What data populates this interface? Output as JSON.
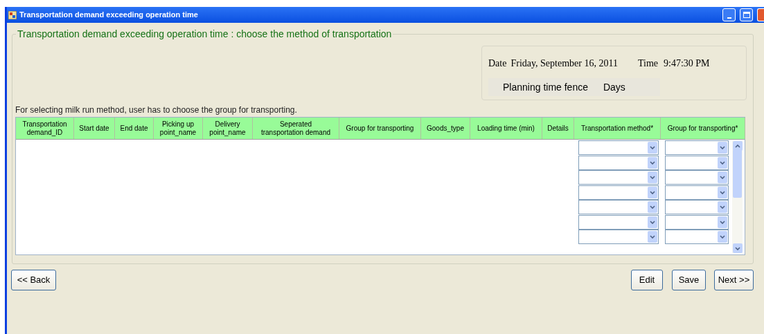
{
  "window": {
    "title": "Transportation demand exceeding operation time"
  },
  "group": {
    "title": "Transportation demand exceeding operation time : choose the method of transportation"
  },
  "info": {
    "date_label": "Date",
    "date": "Friday, September 16, 2011",
    "time_label": "Time",
    "time": "9:47:30 PM",
    "fence_label": "Planning time fence",
    "fence_unit": "Days"
  },
  "instruction": "For selecting milk run method, user has to choose the group for transporting.",
  "table": {
    "columns": [
      {
        "label": "Transportation demand_ID",
        "kind": "text"
      },
      {
        "label": "Start date",
        "kind": "text"
      },
      {
        "label": "End date",
        "kind": "text"
      },
      {
        "label": "Picking up point_name",
        "kind": "text"
      },
      {
        "label": "Delivery point_name",
        "kind": "text"
      },
      {
        "label": "Seperated transportation demand",
        "kind": "text"
      },
      {
        "label": "Group for transporting",
        "kind": "text"
      },
      {
        "label": "Goods_type",
        "kind": "text"
      },
      {
        "label": "Loading time (min)",
        "kind": "text"
      },
      {
        "label": "Details",
        "kind": "text"
      },
      {
        "label": "Transportation method*",
        "kind": "dropdown"
      },
      {
        "label": "Group for transporting*",
        "kind": "dropdown"
      }
    ],
    "rows": [
      {
        "kind": "empty"
      },
      {
        "kind": "empty"
      },
      {
        "kind": "empty"
      },
      {
        "kind": "empty"
      },
      {
        "kind": "empty"
      },
      {
        "kind": "empty"
      },
      {
        "kind": "empty"
      }
    ]
  },
  "buttons": {
    "back": "<< Back",
    "edit": "Edit",
    "save": "Save",
    "next": "Next >>"
  }
}
